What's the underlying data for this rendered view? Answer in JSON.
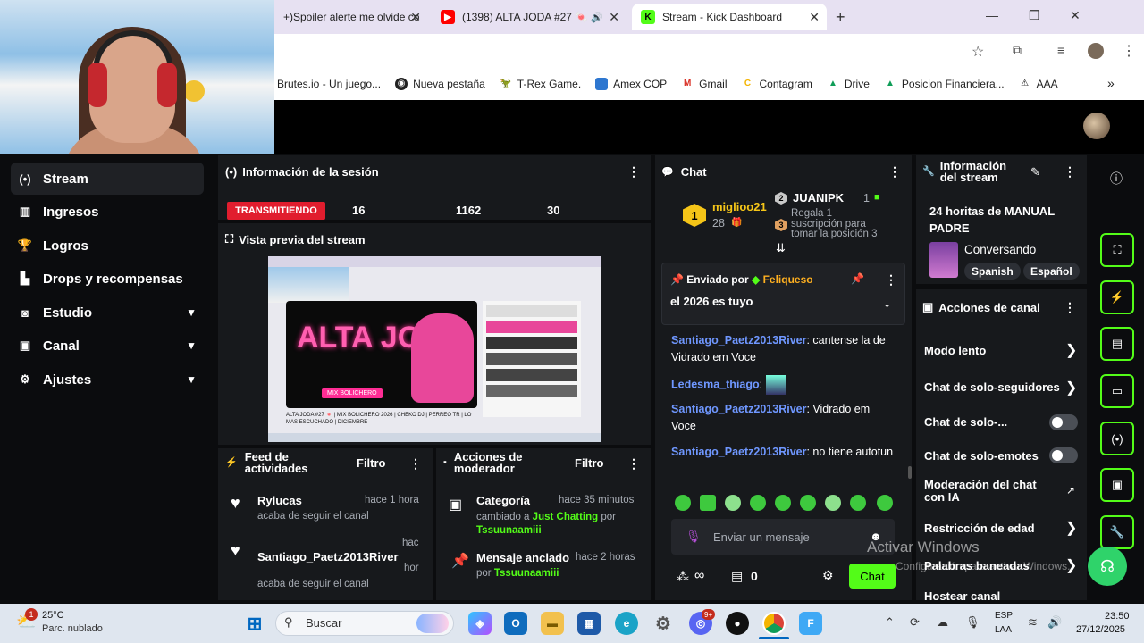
{
  "browser": {
    "tabs": [
      {
        "label": "+)Spoiler alerte me olvide co"
      },
      {
        "label": "(1398) ALTA JODA #27 🍬"
      },
      {
        "label": "Stream - Kick Dashboard"
      }
    ],
    "bookmarks": [
      "Brutes.io - Un juego...",
      "Nueva pestaña",
      "T-Rex Game.",
      "Amex COP",
      "Gmail",
      "Contagram",
      "Drive",
      "Posicion Financiera...",
      "AAA"
    ]
  },
  "sidebar": {
    "items": [
      {
        "label": "Stream"
      },
      {
        "label": "Ingresos"
      },
      {
        "label": "Logros"
      },
      {
        "label": "Drops y recompensas"
      },
      {
        "label": "Estudio"
      },
      {
        "label": "Canal"
      },
      {
        "label": "Ajustes"
      }
    ]
  },
  "session": {
    "title": "Información de la sesión",
    "live_badge": "TRANSMITIENDO",
    "stats": [
      "16",
      "1162",
      "30"
    ]
  },
  "preview": {
    "title": "Vista previa del stream",
    "thumb_title": "ALTA JODA",
    "thumb_sub": "MIX BOLICHERO",
    "thumb_caption": "ALTA JODA #27 🍬 | MIX BOLICHERO 2026 | CHEKO DJ | PERREO TR | LO MAS ESCUCHADO | DICIEMBRE"
  },
  "feed": {
    "title_line1": "Feed de",
    "title_line2": "actividades",
    "filter": "Filtro",
    "items": [
      {
        "user": "Rylucas",
        "time": "hace 1 hora",
        "action": "acaba de seguir el canal"
      },
      {
        "user": "Santiago_Paetz2013River",
        "time": "hac",
        "time2": "hor",
        "action": "acaba de seguir el canal"
      }
    ]
  },
  "mod": {
    "title_line1": "Acciones de",
    "title_line2": "moderador",
    "filter": "Filtro",
    "items": [
      {
        "title": "Categoría",
        "time": "hace 35 minutos",
        "desc_pre": "cambiado a",
        "highlight": "Just Chatting",
        "desc_mid": "por",
        "user": "Tssuunaamiii"
      },
      {
        "title": "Mensaje anclado",
        "time": "hace 2 horas",
        "desc_pre": "por",
        "user": "Tssuunaamiii"
      }
    ]
  },
  "chat": {
    "title": "Chat",
    "leader1": {
      "rank": "1",
      "name": "miglioo21",
      "count": "28"
    },
    "leader2": {
      "rank": "2",
      "name": "JUANIPK",
      "count": "1",
      "gift": "Regala 1",
      "note": "suscripción para tomar la posición 3",
      "rank3": "3"
    },
    "pinned": {
      "label": "Enviado por",
      "user": "Feliqueso",
      "text": "el 2026 es tuyo"
    },
    "messages": [
      {
        "user": "Santiago_Paetz2013River",
        "text": ": cantense la de Vidrado em Voce"
      },
      {
        "user": "Ledesma_thiago",
        "text": ":"
      },
      {
        "user": "Santiago_Paetz2013River",
        "text": ": Vidrado em Voce"
      },
      {
        "user": "Santiago_Paetz2013River",
        "text": ": no tiene autotun"
      }
    ],
    "input_placeholder": "Enviar un mensaje",
    "bottom_count": "0",
    "infinity": "∞",
    "send_label": "Chat"
  },
  "stream_info": {
    "title_line1": "Información",
    "title_line2": "del stream",
    "stream_title": "24 horitas de MANUAL PADRE",
    "category": "Conversando",
    "tags": [
      "Spanish",
      "Español"
    ]
  },
  "channel_actions": {
    "title": "Acciones de canal",
    "items": [
      {
        "label": "Modo lento"
      },
      {
        "label": "Chat de solo-seguidores"
      },
      {
        "label": "Chat de solo-..."
      },
      {
        "label": "Chat de solo-emotes"
      },
      {
        "label": "Moderación del chat con IA"
      },
      {
        "label": "Restricción de edad"
      },
      {
        "label": "Palabras baneadas"
      },
      {
        "label": "Hostear canal"
      }
    ]
  },
  "watermark": {
    "line1": "Activar Windows",
    "line2": "Configuración para activar Windows."
  },
  "taskbar": {
    "weather_temp": "25°C",
    "weather_desc": "Parc. nublado",
    "weather_badge": "1",
    "search": "Buscar",
    "lang1": "ESP",
    "lang2": "LAA",
    "time": "23:50",
    "date": "27/12/2025",
    "badge": "9+"
  },
  "colors": {
    "kick_green": "#53fc18",
    "live_red": "#e11d2e",
    "username_blue": "#6f97ff"
  }
}
